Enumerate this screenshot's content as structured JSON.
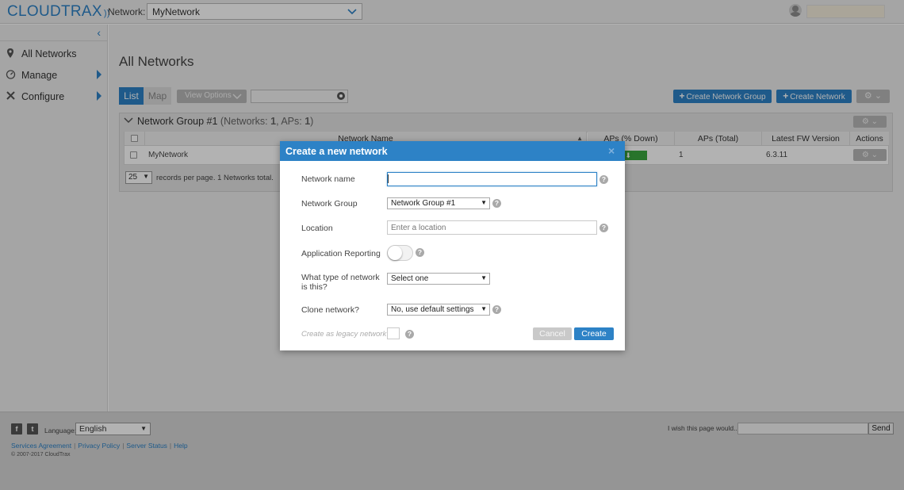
{
  "app": {
    "logo_text": "CLOUDTRAX",
    "logo_signal": "))"
  },
  "topbar": {
    "network_label": "Network:",
    "network_value": "MyNetwork",
    "user_name": ""
  },
  "sidebar": {
    "collapse_glyph": "‹",
    "items": [
      {
        "label": "All Networks",
        "icon": "map-pin-icon"
      },
      {
        "label": "Manage",
        "icon": "dashboard-icon"
      },
      {
        "label": "Configure",
        "icon": "tools-icon"
      }
    ]
  },
  "main": {
    "title": "All Networks",
    "tabs": [
      "List",
      "Map"
    ],
    "view_options_label": "View Options",
    "search_placeholder": "",
    "create_group_label": "Create Network Group",
    "create_network_label": "Create Network"
  },
  "group": {
    "name": "Network Group #1",
    "summary_prefix": "(Networks: ",
    "networks_count": "1",
    "aps_prefix": ", APs: ",
    "aps_count": "1",
    "summary_suffix": ")"
  },
  "table": {
    "columns": [
      "Network Name",
      "APs (% Down)",
      "APs (Total)",
      "Latest FW Version",
      "Actions"
    ],
    "rows": [
      {
        "name": "MyNetwork",
        "aps_down": "0%",
        "aps_total": "1",
        "fw_version": "6.3.11"
      }
    ]
  },
  "pager": {
    "per_page": "25",
    "text": "records per page.  1 Networks total."
  },
  "dialog": {
    "title": "Create a new network",
    "close_glyph": "×",
    "fields": {
      "name_label": "Network name",
      "name_value": "",
      "group_label": "Network Group",
      "group_value": "Network Group #1",
      "location_label": "Location",
      "location_placeholder": "Enter a location",
      "reporting_label": "Application Reporting",
      "reporting_on": false,
      "type_label": "What type of network is this?",
      "type_value": "Select one",
      "clone_label": "Clone network?",
      "clone_value": "No, use default settings",
      "legacy_label": "Create as legacy network"
    },
    "help_glyph": "?",
    "cancel_label": "Cancel",
    "create_label": "Create"
  },
  "footer": {
    "social": [
      "f",
      "t"
    ],
    "language_label": "Language:",
    "language_value": "English",
    "links": [
      "Services Agreement",
      "Privacy Policy",
      "Server Status",
      "Help"
    ],
    "copyright": "© 2007-2017 CloudTrax",
    "wish_label": "I wish this page would...",
    "send_label": "Send"
  },
  "colors": {
    "accent": "#2d82c6",
    "status_green": "#3aa63e"
  }
}
